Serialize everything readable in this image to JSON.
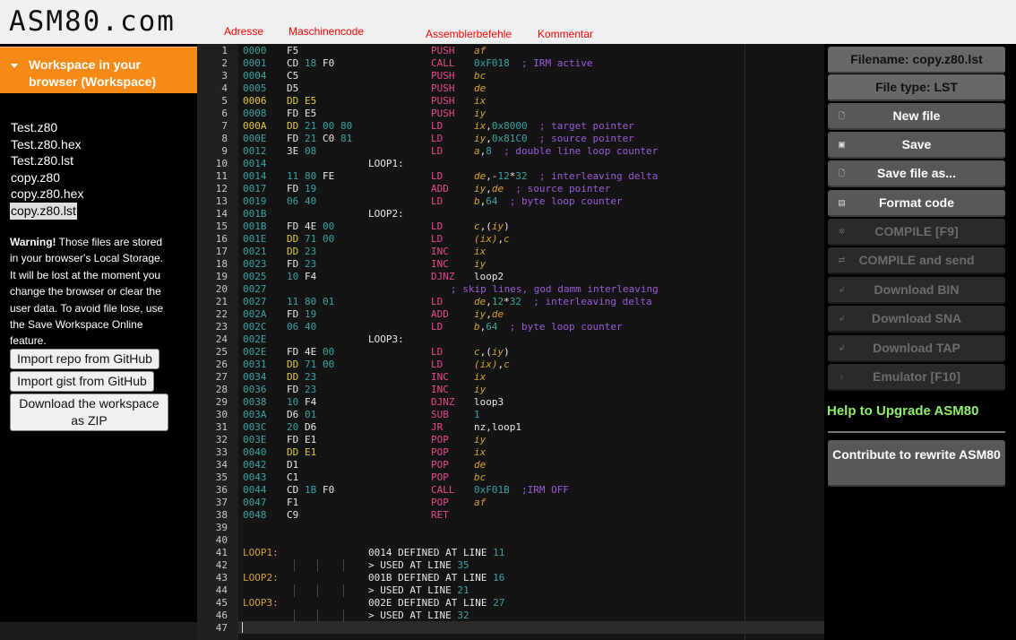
{
  "logo": "ASM80.com",
  "annotations": {
    "address": "Adresse",
    "machine_code": "Maschinencode",
    "assembler": "Assemblerbefehle",
    "comment": "Kommentar"
  },
  "workspace": {
    "title": "Workspace in your browser (Workspace)",
    "files": [
      "Test.z80",
      "Test.z80.hex",
      "Test.z80.lst",
      "copy.z80",
      "copy.z80.hex",
      "copy.z80.lst"
    ],
    "selected_file": "copy.z80.lst",
    "warning_bold": "Warning!",
    "warning_text": " Those files are stored in your browser's Local Storage. It will be lost at the moment you change the browser or clear the user data. To avoid file lose, use the Save Workspace Online feature.",
    "buttons": {
      "import_repo": "Import repo from GitHub",
      "import_gist": "Import gist from GitHub",
      "download_zip": "Download the workspace as ZIP"
    }
  },
  "editor": {
    "lines": [
      {
        "n": "1",
        "addr": "0000",
        "hex": [
          [
            "F5",
            0
          ]
        ],
        "op": "PUSH",
        "args": [
          [
            "af",
            1
          ]
        ]
      },
      {
        "n": "2",
        "addr": "0001",
        "hex": [
          [
            "CD",
            0
          ],
          [
            "18",
            1
          ],
          [
            "F0",
            0
          ]
        ],
        "op": "CALL",
        "args": [
          [
            "0xF018",
            2
          ]
        ],
        "comment": "; IRM active"
      },
      {
        "n": "3",
        "addr": "0004",
        "hex": [
          [
            "C5",
            0
          ]
        ],
        "op": "PUSH",
        "args": [
          [
            "bc",
            1
          ]
        ]
      },
      {
        "n": "4",
        "addr": "0005",
        "hex": [
          [
            "D5",
            0
          ]
        ],
        "op": "PUSH",
        "args": [
          [
            "de",
            1
          ]
        ]
      },
      {
        "n": "5",
        "addr": "0006",
        "ahi": 1,
        "hex": [
          [
            "DD",
            2
          ],
          [
            "E5",
            2
          ]
        ],
        "op": "PUSH",
        "args": [
          [
            "ix",
            1
          ]
        ]
      },
      {
        "n": "6",
        "addr": "0008",
        "hex": [
          [
            "FD",
            0
          ],
          [
            "E5",
            0
          ]
        ],
        "op": "PUSH",
        "args": [
          [
            "iy",
            1
          ]
        ]
      },
      {
        "n": "7",
        "addr": "000A",
        "ahi": 1,
        "hex": [
          [
            "DD",
            2
          ],
          [
            "21",
            1
          ],
          [
            "00",
            1
          ],
          [
            "80",
            1
          ]
        ],
        "op": "LD",
        "args": [
          [
            "ix",
            1
          ],
          [
            ",",
            0
          ],
          [
            "0x8000",
            2
          ]
        ],
        "comment": "; target pointer"
      },
      {
        "n": "8",
        "addr": "000E",
        "hex": [
          [
            "FD",
            0
          ],
          [
            "21",
            1
          ],
          [
            "C0",
            0
          ],
          [
            "81",
            1
          ]
        ],
        "op": "LD",
        "args": [
          [
            "iy",
            1
          ],
          [
            ",",
            0
          ],
          [
            "0x81C0",
            2
          ]
        ],
        "comment": "; source pointer"
      },
      {
        "n": "9",
        "addr": "0012",
        "hex": [
          [
            "3E",
            0
          ],
          [
            "08",
            1
          ]
        ],
        "op": "LD",
        "args": [
          [
            "a",
            1
          ],
          [
            ",",
            0
          ],
          [
            "8",
            2
          ]
        ],
        "comment": "; double line loop counter"
      },
      {
        "n": "10",
        "addr": "0014",
        "label": "LOOP1:"
      },
      {
        "n": "11",
        "addr": "0014",
        "hex": [
          [
            "11",
            1
          ],
          [
            "80",
            1
          ],
          [
            "FE",
            0
          ]
        ],
        "op": "LD",
        "args": [
          [
            "de",
            1
          ],
          [
            ",-",
            0
          ],
          [
            "12",
            2
          ],
          [
            "*",
            0
          ],
          [
            "32",
            2
          ]
        ],
        "comment": "; interleaving delta"
      },
      {
        "n": "12",
        "addr": "0017",
        "hex": [
          [
            "FD",
            0
          ],
          [
            "19",
            1
          ]
        ],
        "op": "ADD",
        "args": [
          [
            "iy",
            1
          ],
          [
            ",",
            0
          ],
          [
            "de",
            1
          ]
        ],
        "comment": "; source pointer"
      },
      {
        "n": "13",
        "addr": "0019",
        "hex": [
          [
            "06",
            1
          ],
          [
            "40",
            1
          ]
        ],
        "op": "LD",
        "args": [
          [
            "b",
            1
          ],
          [
            ",",
            0
          ],
          [
            "64",
            2
          ]
        ],
        "comment": "; byte loop counter"
      },
      {
        "n": "14",
        "addr": "001B",
        "label": "LOOP2:"
      },
      {
        "n": "15",
        "addr": "001B",
        "hex": [
          [
            "FD",
            0
          ],
          [
            "4E",
            0
          ],
          [
            "00",
            1
          ]
        ],
        "op": "LD",
        "args": [
          [
            "c",
            1
          ],
          [
            ",(",
            0
          ],
          [
            "iy",
            1
          ],
          [
            ")",
            0
          ]
        ]
      },
      {
        "n": "16",
        "addr": "001E",
        "hex": [
          [
            "DD",
            2
          ],
          [
            "71",
            1
          ],
          [
            "00",
            1
          ]
        ],
        "op": "LD",
        "args": [
          [
            "(ix)",
            1
          ],
          [
            ",",
            0
          ],
          [
            "c",
            1
          ]
        ]
      },
      {
        "n": "17",
        "addr": "0021",
        "hex": [
          [
            "DD",
            2
          ],
          [
            "23",
            1
          ]
        ],
        "op": "INC",
        "args": [
          [
            "ix",
            1
          ]
        ]
      },
      {
        "n": "18",
        "addr": "0023",
        "hex": [
          [
            "FD",
            0
          ],
          [
            "23",
            1
          ]
        ],
        "op": "INC",
        "args": [
          [
            "iy",
            1
          ]
        ]
      },
      {
        "n": "19",
        "addr": "0025",
        "hex": [
          [
            "10",
            1
          ],
          [
            "F4",
            0
          ]
        ],
        "op": "DJNZ",
        "args": [
          [
            "loop2",
            0
          ]
        ]
      },
      {
        "n": "20",
        "addr": "0027",
        "comment_only": "; skip lines, god damm interleaving"
      },
      {
        "n": "21",
        "addr": "0027",
        "hex": [
          [
            "11",
            1
          ],
          [
            "80",
            1
          ],
          [
            "01",
            1
          ]
        ],
        "op": "LD",
        "args": [
          [
            "de",
            1
          ],
          [
            ",",
            0
          ],
          [
            "12",
            2
          ],
          [
            "*",
            0
          ],
          [
            "32",
            2
          ]
        ],
        "comment": "; interleaving delta"
      },
      {
        "n": "22",
        "addr": "002A",
        "hex": [
          [
            "FD",
            0
          ],
          [
            "19",
            1
          ]
        ],
        "op": "ADD",
        "args": [
          [
            "iy",
            1
          ],
          [
            ",",
            0
          ],
          [
            "de",
            1
          ]
        ]
      },
      {
        "n": "23",
        "addr": "002C",
        "hex": [
          [
            "06",
            1
          ],
          [
            "40",
            1
          ]
        ],
        "op": "LD",
        "args": [
          [
            "b",
            1
          ],
          [
            ",",
            0
          ],
          [
            "64",
            2
          ]
        ],
        "comment": "; byte loop counter"
      },
      {
        "n": "24",
        "addr": "002E",
        "label": "LOOP3:"
      },
      {
        "n": "25",
        "addr": "002E",
        "hex": [
          [
            "FD",
            0
          ],
          [
            "4E",
            0
          ],
          [
            "00",
            1
          ]
        ],
        "op": "LD",
        "args": [
          [
            "c",
            1
          ],
          [
            ",(",
            0
          ],
          [
            "iy",
            1
          ],
          [
            ")",
            0
          ]
        ]
      },
      {
        "n": "26",
        "addr": "0031",
        "hex": [
          [
            "DD",
            2
          ],
          [
            "71",
            1
          ],
          [
            "00",
            1
          ]
        ],
        "op": "LD",
        "args": [
          [
            "(ix)",
            1
          ],
          [
            ",",
            0
          ],
          [
            "c",
            1
          ]
        ]
      },
      {
        "n": "27",
        "addr": "0034",
        "hex": [
          [
            "DD",
            2
          ],
          [
            "23",
            1
          ]
        ],
        "op": "INC",
        "args": [
          [
            "ix",
            1
          ]
        ]
      },
      {
        "n": "28",
        "addr": "0036",
        "hex": [
          [
            "FD",
            0
          ],
          [
            "23",
            1
          ]
        ],
        "op": "INC",
        "args": [
          [
            "iy",
            1
          ]
        ]
      },
      {
        "n": "29",
        "addr": "0038",
        "hex": [
          [
            "10",
            1
          ],
          [
            "F4",
            0
          ]
        ],
        "op": "DJNZ",
        "args": [
          [
            "loop3",
            0
          ]
        ]
      },
      {
        "n": "30",
        "addr": "003A",
        "hex": [
          [
            "D6",
            0
          ],
          [
            "01",
            1
          ]
        ],
        "op": "SUB",
        "args": [
          [
            "1",
            2
          ]
        ]
      },
      {
        "n": "31",
        "addr": "003C",
        "hex": [
          [
            "20",
            1
          ],
          [
            "D6",
            0
          ]
        ],
        "op": "JR",
        "args": [
          [
            "nz,loop1",
            0
          ]
        ]
      },
      {
        "n": "32",
        "addr": "003E",
        "hex": [
          [
            "FD",
            0
          ],
          [
            "E1",
            0
          ]
        ],
        "op": "POP",
        "args": [
          [
            "iy",
            1
          ]
        ]
      },
      {
        "n": "33",
        "addr": "0040",
        "hex": [
          [
            "DD",
            2
          ],
          [
            "E1",
            2
          ]
        ],
        "op": "POP",
        "args": [
          [
            "ix",
            1
          ]
        ]
      },
      {
        "n": "34",
        "addr": "0042",
        "hex": [
          [
            "D1",
            0
          ]
        ],
        "op": "POP",
        "args": [
          [
            "de",
            1
          ]
        ]
      },
      {
        "n": "35",
        "addr": "0043",
        "hex": [
          [
            "C1",
            0
          ]
        ],
        "op": "POP",
        "args": [
          [
            "bc",
            1
          ]
        ]
      },
      {
        "n": "36",
        "addr": "0044",
        "hex": [
          [
            "CD",
            0
          ],
          [
            "1B",
            1
          ],
          [
            "F0",
            0
          ]
        ],
        "op": "CALL",
        "args": [
          [
            "0xF01B",
            2
          ]
        ],
        "comment": ";IRM OFF"
      },
      {
        "n": "37",
        "addr": "0047",
        "hex": [
          [
            "F1",
            0
          ]
        ],
        "op": "POP",
        "args": [
          [
            "af",
            1
          ]
        ]
      },
      {
        "n": "38",
        "addr": "0048",
        "hex": [
          [
            "C9",
            0
          ]
        ],
        "op": "RET",
        "args": []
      },
      {
        "n": "39"
      },
      {
        "n": "40"
      },
      {
        "n": "41",
        "sym": "LOOP1:",
        "symval": "0014",
        "symtext": " DEFINED AT LINE ",
        "symline": "11"
      },
      {
        "n": "42",
        "used": "> USED AT LINE ",
        "usedline": "35"
      },
      {
        "n": "43",
        "sym": "LOOP2:",
        "symval": "001B",
        "symtext": " DEFINED AT LINE ",
        "symline": "16"
      },
      {
        "n": "44",
        "used": "> USED AT LINE ",
        "usedline": "21"
      },
      {
        "n": "45",
        "sym": "LOOP3:",
        "symval": "002E",
        "symtext": " DEFINED AT LINE ",
        "symline": "27"
      },
      {
        "n": "46",
        "used": "> USED AT LINE ",
        "usedline": "32"
      },
      {
        "n": "47"
      }
    ]
  },
  "right": {
    "filename": "Filename: copy.z80.lst",
    "filetype": "File type: LST",
    "buttons": [
      {
        "label": "New file",
        "icon": "file-icon",
        "glyph": "🗋",
        "state": "enabled"
      },
      {
        "label": "Save",
        "icon": "save-icon",
        "glyph": "▣",
        "state": "enabled"
      },
      {
        "label": "Save file as...",
        "icon": "save-as-icon",
        "glyph": "🗋",
        "state": "enabled"
      },
      {
        "label": "Format code",
        "icon": "clipboard-icon",
        "glyph": "▤",
        "state": "enabled"
      },
      {
        "label": "COMPILE [F9]",
        "icon": "gear-icon",
        "glyph": "✲",
        "state": "disabled"
      },
      {
        "label": "COMPILE and send",
        "icon": "send-icon",
        "glyph": "⇄",
        "state": "disabled"
      },
      {
        "label": "Download BIN",
        "icon": "download-icon",
        "glyph": "↲",
        "state": "disabled"
      },
      {
        "label": "Download SNA",
        "icon": "download-icon",
        "glyph": "↲",
        "state": "disabled"
      },
      {
        "label": "Download TAP",
        "icon": "download-icon",
        "glyph": "↲",
        "state": "disabled"
      },
      {
        "label": "Emulator [F10]",
        "icon": "bulb-icon",
        "glyph": "♁",
        "state": "disabled"
      }
    ],
    "help": "Help to Upgrade ASM80",
    "contribute": "Contribute to rewrite ASM80"
  },
  "colors": {
    "accent_orange": "#f58a16",
    "help_green": "#8cf06a",
    "annotation_red": "#ff0000"
  }
}
